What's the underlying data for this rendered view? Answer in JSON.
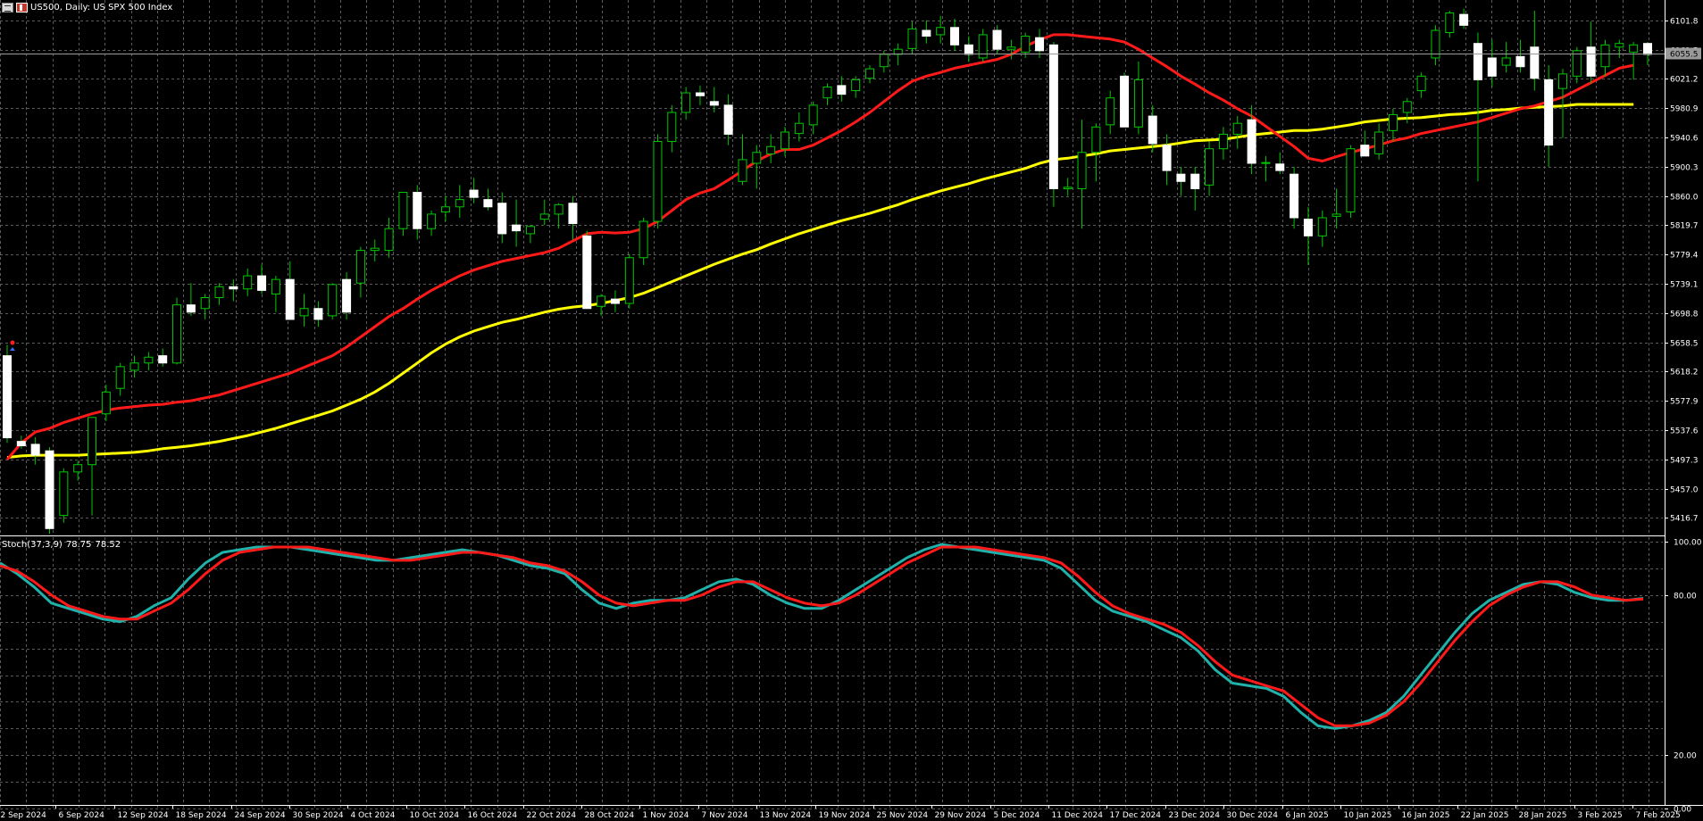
{
  "header": {
    "title": "US500, Daily:  US SPX 500 Index"
  },
  "price_axis": {
    "ticks": [
      "6101.8",
      "6061.5",
      "6021.2",
      "5980.9",
      "5940.6",
      "5900.3",
      "5860.0",
      "5819.7",
      "5779.4",
      "5739.1",
      "5698.8",
      "5658.5",
      "5618.2",
      "5577.9",
      "5537.6",
      "5497.3",
      "5457.0",
      "5416.7"
    ],
    "current_price_label": "6055.5",
    "current_price": 6055.5
  },
  "stoch": {
    "label": "Stoch(37,3,9)",
    "main_value": "78.75",
    "signal_value": "78.52",
    "ticks": [
      "100.00",
      "80.00",
      "20.00",
      "0.00"
    ]
  },
  "date_axis": {
    "labels": [
      "2 Sep 2024",
      "6 Sep 2024",
      "12 Sep 2024",
      "18 Sep 2024",
      "24 Sep 2024",
      "30 Sep 2024",
      "4 Oct 2024",
      "10 Oct 2024",
      "16 Oct 2024",
      "22 Oct 2024",
      "28 Oct 2024",
      "1 Nov 2024",
      "7 Nov 2024",
      "13 Nov 2024",
      "19 Nov 2024",
      "25 Nov 2024",
      "29 Nov 2024",
      "5 Dec 2024",
      "11 Dec 2024",
      "17 Dec 2024",
      "23 Dec 2024",
      "30 Dec 2024",
      "6 Jan 2025",
      "10 Jan 2025",
      "16 Jan 2025",
      "22 Jan 2025",
      "28 Jan 2025",
      "3 Feb 2025",
      "7 Feb 2025"
    ]
  },
  "colors": {
    "background": "#000000",
    "grid": "#5a5a5a",
    "bull_body": "#000000",
    "bull_wick": "#00c800",
    "bear_body": "#ffffff",
    "bear_wick": "#00c800",
    "ma_fast": "#ff1a1a",
    "ma_slow": "#ffff00",
    "stoch_main": "#20b2aa",
    "stoch_signal": "#ff1a1a",
    "axis_text": "#ffffff"
  },
  "chart_data": {
    "type": "candlestick",
    "symbol": "US500",
    "timeframe": "Daily",
    "title": "US SPX 500 Index",
    "ylim": [
      5395,
      6120
    ],
    "candles": [
      {
        "o": 5640,
        "h": 5655,
        "l": 5520,
        "c": 5527
      },
      {
        "o": 5522,
        "h": 5530,
        "l": 5512,
        "c": 5516
      },
      {
        "o": 5518,
        "h": 5528,
        "l": 5490,
        "c": 5503
      },
      {
        "o": 5509,
        "h": 5514,
        "l": 5395,
        "c": 5402
      },
      {
        "o": 5420,
        "h": 5485,
        "l": 5410,
        "c": 5480
      },
      {
        "o": 5480,
        "h": 5495,
        "l": 5468,
        "c": 5490
      },
      {
        "o": 5490,
        "h": 5555,
        "l": 5420,
        "c": 5555
      },
      {
        "o": 5560,
        "h": 5600,
        "l": 5550,
        "c": 5590
      },
      {
        "o": 5595,
        "h": 5630,
        "l": 5585,
        "c": 5625
      },
      {
        "o": 5620,
        "h": 5640,
        "l": 5610,
        "c": 5630
      },
      {
        "o": 5630,
        "h": 5645,
        "l": 5620,
        "c": 5638
      },
      {
        "o": 5640,
        "h": 5650,
        "l": 5625,
        "c": 5630
      },
      {
        "o": 5630,
        "h": 5720,
        "l": 5628,
        "c": 5710
      },
      {
        "o": 5710,
        "h": 5740,
        "l": 5695,
        "c": 5700
      },
      {
        "o": 5705,
        "h": 5725,
        "l": 5690,
        "c": 5720
      },
      {
        "o": 5720,
        "h": 5740,
        "l": 5710,
        "c": 5735
      },
      {
        "o": 5735,
        "h": 5745,
        "l": 5715,
        "c": 5732
      },
      {
        "o": 5732,
        "h": 5760,
        "l": 5722,
        "c": 5750
      },
      {
        "o": 5750,
        "h": 5765,
        "l": 5725,
        "c": 5730
      },
      {
        "o": 5725,
        "h": 5750,
        "l": 5700,
        "c": 5745
      },
      {
        "o": 5745,
        "h": 5770,
        "l": 5730,
        "c": 5690
      },
      {
        "o": 5695,
        "h": 5725,
        "l": 5680,
        "c": 5705
      },
      {
        "o": 5705,
        "h": 5715,
        "l": 5680,
        "c": 5690
      },
      {
        "o": 5695,
        "h": 5740,
        "l": 5690,
        "c": 5738
      },
      {
        "o": 5745,
        "h": 5755,
        "l": 5690,
        "c": 5700
      },
      {
        "o": 5740,
        "h": 5790,
        "l": 5720,
        "c": 5785
      },
      {
        "o": 5785,
        "h": 5800,
        "l": 5770,
        "c": 5788
      },
      {
        "o": 5785,
        "h": 5830,
        "l": 5775,
        "c": 5815
      },
      {
        "o": 5815,
        "h": 5860,
        "l": 5805,
        "c": 5865
      },
      {
        "o": 5865,
        "h": 5875,
        "l": 5800,
        "c": 5815
      },
      {
        "o": 5815,
        "h": 5840,
        "l": 5805,
        "c": 5835
      },
      {
        "o": 5838,
        "h": 5860,
        "l": 5825,
        "c": 5845
      },
      {
        "o": 5845,
        "h": 5875,
        "l": 5830,
        "c": 5855
      },
      {
        "o": 5868,
        "h": 5885,
        "l": 5850,
        "c": 5858
      },
      {
        "o": 5855,
        "h": 5870,
        "l": 5840,
        "c": 5845
      },
      {
        "o": 5850,
        "h": 5865,
        "l": 5795,
        "c": 5808
      },
      {
        "o": 5820,
        "h": 5855,
        "l": 5790,
        "c": 5812
      },
      {
        "o": 5808,
        "h": 5820,
        "l": 5795,
        "c": 5818
      },
      {
        "o": 5828,
        "h": 5855,
        "l": 5820,
        "c": 5835
      },
      {
        "o": 5835,
        "h": 5850,
        "l": 5815,
        "c": 5848
      },
      {
        "o": 5850,
        "h": 5860,
        "l": 5800,
        "c": 5822
      },
      {
        "o": 5805,
        "h": 5812,
        "l": 5708,
        "c": 5705
      },
      {
        "o": 5708,
        "h": 5725,
        "l": 5695,
        "c": 5722
      },
      {
        "o": 5718,
        "h": 5730,
        "l": 5700,
        "c": 5712
      },
      {
        "o": 5712,
        "h": 5780,
        "l": 5705,
        "c": 5775
      },
      {
        "o": 5775,
        "h": 5830,
        "l": 5765,
        "c": 5825
      },
      {
        "o": 5825,
        "h": 5945,
        "l": 5815,
        "c": 5935
      },
      {
        "o": 5935,
        "h": 5985,
        "l": 5920,
        "c": 5975
      },
      {
        "o": 5975,
        "h": 6010,
        "l": 5965,
        "c": 6002
      },
      {
        "o": 6002,
        "h": 6012,
        "l": 5985,
        "c": 5998
      },
      {
        "o": 5990,
        "h": 6010,
        "l": 5975,
        "c": 5985
      },
      {
        "o": 5985,
        "h": 6000,
        "l": 5930,
        "c": 5945
      },
      {
        "o": 5880,
        "h": 5945,
        "l": 5875,
        "c": 5910
      },
      {
        "o": 5905,
        "h": 5930,
        "l": 5870,
        "c": 5920
      },
      {
        "o": 5918,
        "h": 5945,
        "l": 5905,
        "c": 5928
      },
      {
        "o": 5925,
        "h": 5955,
        "l": 5915,
        "c": 5948
      },
      {
        "o": 5946,
        "h": 5975,
        "l": 5935,
        "c": 5960
      },
      {
        "o": 5958,
        "h": 5990,
        "l": 5945,
        "c": 5985
      },
      {
        "o": 5995,
        "h": 6015,
        "l": 5985,
        "c": 6010
      },
      {
        "o": 6012,
        "h": 6025,
        "l": 5990,
        "c": 6000
      },
      {
        "o": 6005,
        "h": 6025,
        "l": 5995,
        "c": 6020
      },
      {
        "o": 6022,
        "h": 6040,
        "l": 6015,
        "c": 6035
      },
      {
        "o": 6038,
        "h": 6060,
        "l": 6030,
        "c": 6055
      },
      {
        "o": 6055,
        "h": 6070,
        "l": 6040,
        "c": 6062
      },
      {
        "o": 6063,
        "h": 6100,
        "l": 6055,
        "c": 6090
      },
      {
        "o": 6088,
        "h": 6102,
        "l": 6070,
        "c": 6080
      },
      {
        "o": 6082,
        "h": 6108,
        "l": 6070,
        "c": 6092
      },
      {
        "o": 6092,
        "h": 6104,
        "l": 6060,
        "c": 6068
      },
      {
        "o": 6068,
        "h": 6080,
        "l": 6045,
        "c": 6055
      },
      {
        "o": 6050,
        "h": 6090,
        "l": 6045,
        "c": 6082
      },
      {
        "o": 6088,
        "h": 6095,
        "l": 6055,
        "c": 6062
      },
      {
        "o": 6062,
        "h": 6075,
        "l": 6048,
        "c": 6065
      },
      {
        "o": 6058,
        "h": 6085,
        "l": 6050,
        "c": 6080
      },
      {
        "o": 6078,
        "h": 6090,
        "l": 6050,
        "c": 6060
      },
      {
        "o": 6068,
        "h": 6072,
        "l": 5845,
        "c": 5870
      },
      {
        "o": 5870,
        "h": 5885,
        "l": 5860,
        "c": 5872
      },
      {
        "o": 5870,
        "h": 5965,
        "l": 5815,
        "c": 5920
      },
      {
        "o": 5920,
        "h": 5960,
        "l": 5880,
        "c": 5955
      },
      {
        "o": 5958,
        "h": 6005,
        "l": 5945,
        "c": 5995
      },
      {
        "o": 6025,
        "h": 6030,
        "l": 5955,
        "c": 5955
      },
      {
        "o": 5955,
        "h": 6045,
        "l": 5945,
        "c": 6020
      },
      {
        "o": 5970,
        "h": 5985,
        "l": 5920,
        "c": 5932
      },
      {
        "o": 5930,
        "h": 5945,
        "l": 5875,
        "c": 5895
      },
      {
        "o": 5890,
        "h": 5900,
        "l": 5860,
        "c": 5880
      },
      {
        "o": 5890,
        "h": 5900,
        "l": 5840,
        "c": 5870
      },
      {
        "o": 5875,
        "h": 5935,
        "l": 5860,
        "c": 5925
      },
      {
        "o": 5925,
        "h": 5955,
        "l": 5910,
        "c": 5945
      },
      {
        "o": 5945,
        "h": 5970,
        "l": 5925,
        "c": 5960
      },
      {
        "o": 5965,
        "h": 5985,
        "l": 5890,
        "c": 5905
      },
      {
        "o": 5905,
        "h": 5915,
        "l": 5880,
        "c": 5906
      },
      {
        "o": 5904,
        "h": 5920,
        "l": 5890,
        "c": 5895
      },
      {
        "o": 5890,
        "h": 5900,
        "l": 5815,
        "c": 5830
      },
      {
        "o": 5828,
        "h": 5845,
        "l": 5765,
        "c": 5805
      },
      {
        "o": 5805,
        "h": 5840,
        "l": 5790,
        "c": 5830
      },
      {
        "o": 5832,
        "h": 5870,
        "l": 5815,
        "c": 5835
      },
      {
        "o": 5838,
        "h": 5930,
        "l": 5830,
        "c": 5925
      },
      {
        "o": 5930,
        "h": 5950,
        "l": 5915,
        "c": 5915
      },
      {
        "o": 5918,
        "h": 5960,
        "l": 5910,
        "c": 5948
      },
      {
        "o": 5950,
        "h": 5980,
        "l": 5935,
        "c": 5972
      },
      {
        "o": 5975,
        "h": 5995,
        "l": 5960,
        "c": 5990
      },
      {
        "o": 6005,
        "h": 6030,
        "l": 5995,
        "c": 6025
      },
      {
        "o": 6050,
        "h": 6095,
        "l": 6040,
        "c": 6088
      },
      {
        "o": 6085,
        "h": 6115,
        "l": 6078,
        "c": 6112
      },
      {
        "o": 6110,
        "h": 6118,
        "l": 6090,
        "c": 6095
      },
      {
        "o": 6070,
        "h": 6085,
        "l": 5880,
        "c": 6020
      },
      {
        "o": 6050,
        "h": 6075,
        "l": 6010,
        "c": 6025
      },
      {
        "o": 6040,
        "h": 6072,
        "l": 6030,
        "c": 6050
      },
      {
        "o": 6052,
        "h": 6075,
        "l": 6030,
        "c": 6038
      },
      {
        "o": 6065,
        "h": 6115,
        "l": 6005,
        "c": 6022
      },
      {
        "o": 6020,
        "h": 6040,
        "l": 5900,
        "c": 5930
      },
      {
        "o": 6008,
        "h": 6035,
        "l": 5940,
        "c": 6028
      },
      {
        "o": 6025,
        "h": 6065,
        "l": 6015,
        "c": 6060
      },
      {
        "o": 6065,
        "h": 6100,
        "l": 6015,
        "c": 6025
      },
      {
        "o": 6038,
        "h": 6075,
        "l": 6025,
        "c": 6068
      },
      {
        "o": 6065,
        "h": 6075,
        "l": 6050,
        "c": 6070
      },
      {
        "o": 6058,
        "h": 6072,
        "l": 6020,
        "c": 6068
      },
      {
        "o": 6070,
        "h": 6072,
        "l": 6040,
        "c": 6055
      }
    ],
    "ma_fast": [
      5497,
      5520,
      5535,
      5540,
      5548,
      5554,
      5560,
      5565,
      5568,
      5570,
      5572,
      5573,
      5576,
      5578,
      5582,
      5586,
      5592,
      5598,
      5604,
      5610,
      5616,
      5624,
      5632,
      5640,
      5652,
      5666,
      5680,
      5694,
      5705,
      5718,
      5730,
      5740,
      5750,
      5758,
      5764,
      5770,
      5774,
      5778,
      5782,
      5788,
      5798,
      5808,
      5810,
      5809,
      5810,
      5815,
      5825,
      5840,
      5855,
      5864,
      5870,
      5882,
      5895,
      5908,
      5918,
      5924,
      5924,
      5930,
      5940,
      5950,
      5962,
      5975,
      5990,
      6005,
      6018,
      6025,
      6030,
      6036,
      6040,
      6044,
      6048,
      6055,
      6066,
      6075,
      6082,
      6082,
      6080,
      6078,
      6076,
      6072,
      6062,
      6050,
      6038,
      6025,
      6014,
      6002,
      5992,
      5980,
      5970,
      5956,
      5942,
      5928,
      5912,
      5908,
      5914,
      5920,
      5925,
      5930,
      5936,
      5940,
      5946,
      5950,
      5954,
      5958,
      5962,
      5968,
      5974,
      5980,
      5984,
      5990,
      5996,
      6006,
      6016,
      6026,
      6036,
      6040
    ],
    "ma_slow": [
      5500,
      5502,
      5503,
      5503,
      5503,
      5503,
      5504,
      5505,
      5506,
      5507,
      5509,
      5512,
      5514,
      5516,
      5519,
      5522,
      5526,
      5530,
      5535,
      5540,
      5546,
      5552,
      5558,
      5564,
      5572,
      5580,
      5590,
      5602,
      5616,
      5630,
      5644,
      5656,
      5666,
      5674,
      5680,
      5686,
      5690,
      5695,
      5700,
      5704,
      5707,
      5709,
      5712,
      5716,
      5720,
      5726,
      5734,
      5742,
      5750,
      5758,
      5766,
      5773,
      5780,
      5786,
      5794,
      5801,
      5808,
      5814,
      5820,
      5826,
      5831,
      5836,
      5842,
      5848,
      5855,
      5861,
      5867,
      5872,
      5877,
      5883,
      5888,
      5893,
      5898,
      5905,
      5910,
      5912,
      5915,
      5918,
      5922,
      5924,
      5926,
      5928,
      5930,
      5933,
      5936,
      5937,
      5938,
      5941,
      5944,
      5946,
      5948,
      5950,
      5950,
      5952,
      5955,
      5958,
      5962,
      5964,
      5966,
      5967,
      5968,
      5970,
      5972,
      5973,
      5975,
      5978,
      5979,
      5981,
      5982,
      5983,
      5984,
      5986,
      5986,
      5986,
      5986,
      5986
    ],
    "stoch_main": [
      92,
      88,
      83,
      77,
      75,
      73,
      71,
      70,
      72,
      76,
      79,
      86,
      92,
      96,
      97,
      98,
      98,
      98,
      97,
      96,
      95,
      94,
      93,
      93,
      94,
      95,
      96,
      97,
      96,
      95,
      93,
      91,
      90,
      88,
      82,
      77,
      75,
      77,
      78,
      78,
      79,
      82,
      85,
      86,
      84,
      80,
      77,
      75,
      75,
      78,
      82,
      86,
      90,
      94,
      97,
      99,
      98,
      97,
      96,
      95,
      94,
      93,
      90,
      84,
      78,
      74,
      72,
      70,
      67,
      64,
      59,
      52,
      47,
      46,
      45,
      42,
      36,
      31,
      30,
      31,
      33,
      36,
      42,
      50,
      58,
      66,
      73,
      78,
      81,
      84,
      85,
      84,
      81,
      79,
      78,
      78,
      78.75
    ],
    "stoch_signal": [
      91,
      89,
      85,
      80,
      76,
      74,
      72,
      71,
      71,
      74,
      77,
      82,
      88,
      93,
      96,
      97,
      98,
      98,
      98,
      97,
      96,
      95,
      94,
      93,
      93,
      94,
      95,
      96,
      96,
      95,
      94,
      92,
      91,
      89,
      85,
      80,
      77,
      76,
      77,
      78,
      78,
      80,
      83,
      85,
      85,
      82,
      79,
      77,
      76,
      77,
      80,
      84,
      88,
      92,
      95,
      98,
      98,
      98,
      97,
      96,
      95,
      94,
      92,
      87,
      81,
      76,
      73,
      71,
      69,
      66,
      61,
      55,
      50,
      48,
      46,
      44,
      39,
      34,
      31,
      31,
      32,
      35,
      40,
      47,
      55,
      63,
      70,
      76,
      80,
      83,
      85,
      85,
      83,
      80,
      79,
      78,
      78.52
    ]
  }
}
